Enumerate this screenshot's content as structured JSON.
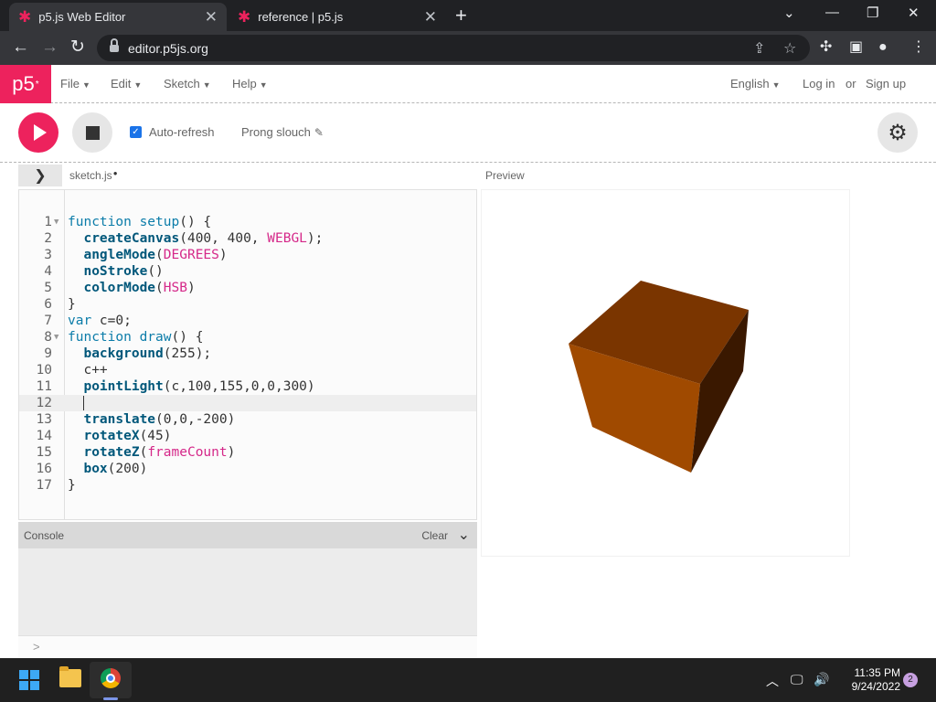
{
  "browser": {
    "tabs": [
      {
        "title": "p5.js Web Editor",
        "active": true
      },
      {
        "title": "reference | p5.js",
        "active": false
      }
    ],
    "url": "editor.p5js.org"
  },
  "nav": {
    "logo": "p5",
    "logo_sup": "*",
    "menus": [
      "File",
      "Edit",
      "Sketch",
      "Help"
    ],
    "language": "English",
    "login": "Log in",
    "or": "or",
    "signup": "Sign up"
  },
  "toolbar": {
    "auto_refresh_label": "Auto-refresh",
    "auto_refresh_checked": true,
    "sketch_name": "Prong slouch"
  },
  "editor": {
    "file_name": "sketch.js",
    "preview_label": "Preview",
    "current_line": 12,
    "lines": [
      "function setup() {",
      "  createCanvas(400, 400, WEBGL);",
      "  angleMode(DEGREES)",
      "  noStroke()",
      "  colorMode(HSB)",
      "}",
      "var c=0;",
      "function draw() {",
      "  background(255);",
      "  c++",
      "  pointLight(c,100,155,0,0,300)",
      "  ",
      "  translate(0,0,-200)",
      "  rotateX(45)",
      "  rotateZ(frameCount)",
      "  box(200)",
      "}"
    ]
  },
  "console": {
    "title": "Console",
    "clear": "Clear",
    "prompt": ">"
  },
  "preview": {
    "cube_top": "#7a3500",
    "cube_left": "#a04a00",
    "cube_right": "#3a1800"
  },
  "taskbar": {
    "time": "11:35 PM",
    "date": "9/24/2022",
    "notifications": "2"
  }
}
